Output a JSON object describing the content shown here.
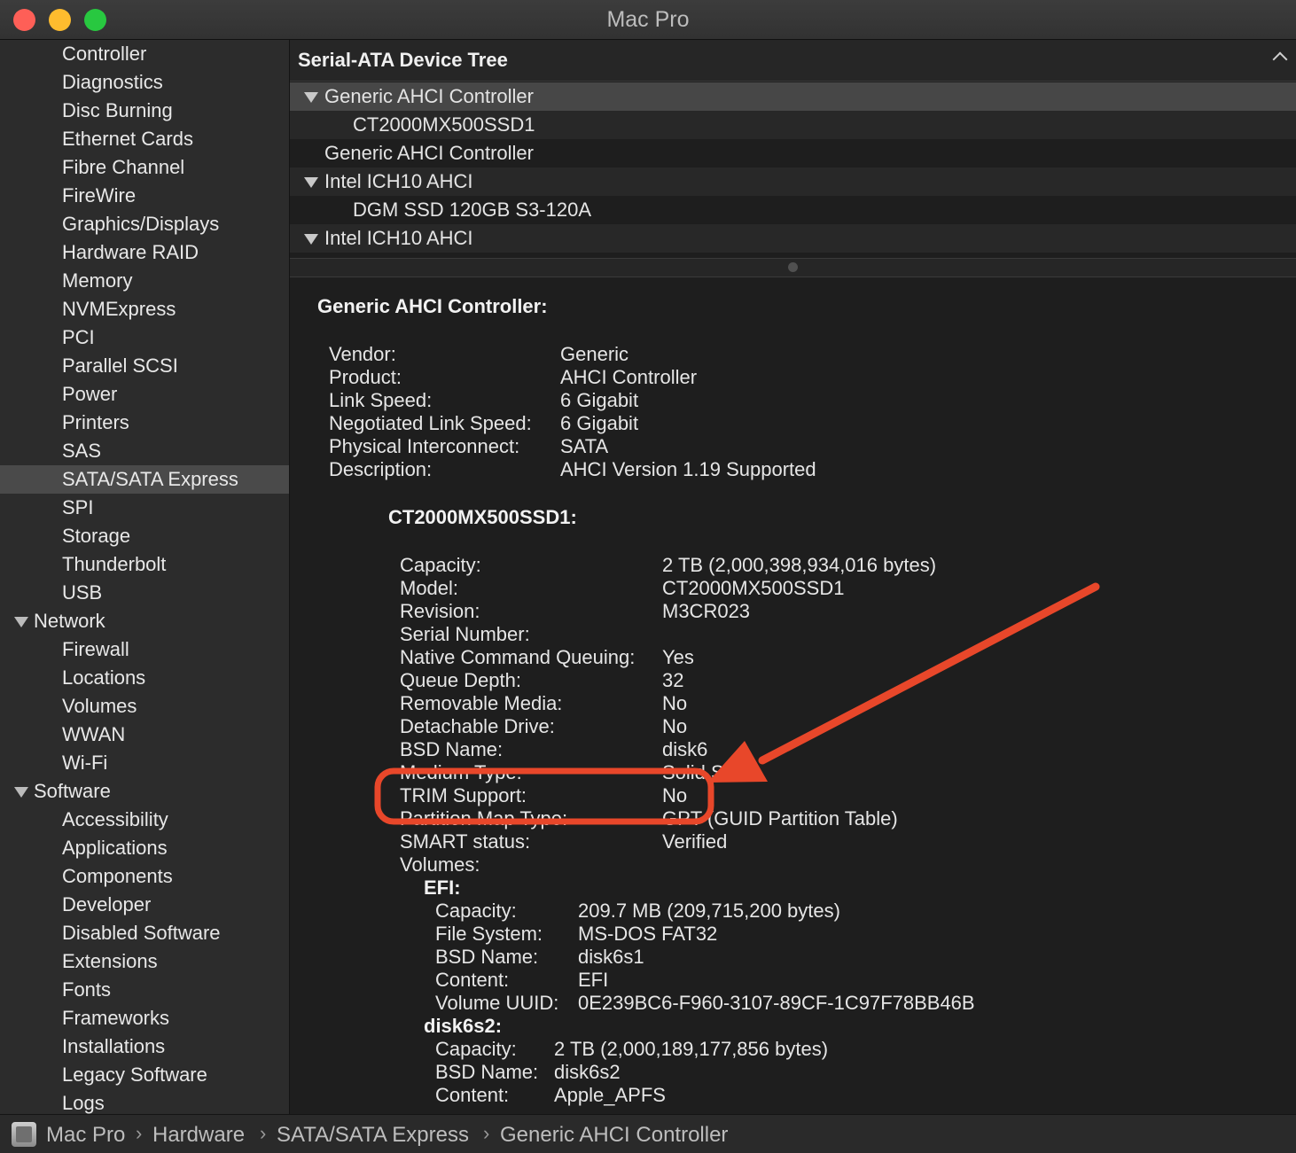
{
  "window": {
    "title": "Mac Pro"
  },
  "sidebar": {
    "items": [
      {
        "label": "Controller",
        "kind": "item"
      },
      {
        "label": "Diagnostics",
        "kind": "item"
      },
      {
        "label": "Disc Burning",
        "kind": "item"
      },
      {
        "label": "Ethernet Cards",
        "kind": "item"
      },
      {
        "label": "Fibre Channel",
        "kind": "item"
      },
      {
        "label": "FireWire",
        "kind": "item"
      },
      {
        "label": "Graphics/Displays",
        "kind": "item"
      },
      {
        "label": "Hardware RAID",
        "kind": "item"
      },
      {
        "label": "Memory",
        "kind": "item"
      },
      {
        "label": "NVMExpress",
        "kind": "item"
      },
      {
        "label": "PCI",
        "kind": "item"
      },
      {
        "label": "Parallel SCSI",
        "kind": "item"
      },
      {
        "label": "Power",
        "kind": "item"
      },
      {
        "label": "Printers",
        "kind": "item"
      },
      {
        "label": "SAS",
        "kind": "item"
      },
      {
        "label": "SATA/SATA Express",
        "kind": "item",
        "selected": true
      },
      {
        "label": "SPI",
        "kind": "item"
      },
      {
        "label": "Storage",
        "kind": "item"
      },
      {
        "label": "Thunderbolt",
        "kind": "item"
      },
      {
        "label": "USB",
        "kind": "item"
      },
      {
        "label": "Network",
        "kind": "category"
      },
      {
        "label": "Firewall",
        "kind": "item"
      },
      {
        "label": "Locations",
        "kind": "item"
      },
      {
        "label": "Volumes",
        "kind": "item"
      },
      {
        "label": "WWAN",
        "kind": "item"
      },
      {
        "label": "Wi-Fi",
        "kind": "item"
      },
      {
        "label": "Software",
        "kind": "category"
      },
      {
        "label": "Accessibility",
        "kind": "item"
      },
      {
        "label": "Applications",
        "kind": "item"
      },
      {
        "label": "Components",
        "kind": "item"
      },
      {
        "label": "Developer",
        "kind": "item"
      },
      {
        "label": "Disabled Software",
        "kind": "item"
      },
      {
        "label": "Extensions",
        "kind": "item"
      },
      {
        "label": "Fonts",
        "kind": "item"
      },
      {
        "label": "Frameworks",
        "kind": "item"
      },
      {
        "label": "Installations",
        "kind": "item"
      },
      {
        "label": "Legacy Software",
        "kind": "item"
      },
      {
        "label": "Logs",
        "kind": "item"
      }
    ]
  },
  "device_tree": {
    "title": "Serial-ATA Device Tree",
    "rows": [
      {
        "label": "Generic AHCI Controller",
        "level": 0,
        "expanded": true,
        "selected": true
      },
      {
        "label": "CT2000MX500SSD1",
        "level": 1
      },
      {
        "label": "Generic AHCI Controller",
        "level": 0
      },
      {
        "label": "Intel ICH10 AHCI",
        "level": 0,
        "expanded": true
      },
      {
        "label": "DGM SSD 120GB S3-120A",
        "level": 1
      },
      {
        "label": "Intel ICH10 AHCI",
        "level": 0,
        "expanded": true
      }
    ]
  },
  "detail": {
    "title": "Generic AHCI Controller:",
    "controller_fields": [
      {
        "key": "Vendor:",
        "value": "Generic"
      },
      {
        "key": "Product:",
        "value": "AHCI Controller"
      },
      {
        "key": "Link Speed:",
        "value": "6 Gigabit"
      },
      {
        "key": "Negotiated Link Speed:",
        "value": "6 Gigabit"
      },
      {
        "key": "Physical Interconnect:",
        "value": "SATA"
      },
      {
        "key": "Description:",
        "value": "AHCI Version 1.19 Supported"
      }
    ],
    "device_title": "CT2000MX500SSD1:",
    "device_fields": [
      {
        "key": "Capacity:",
        "value": "2 TB (2,000,398,934,016 bytes)"
      },
      {
        "key": "Model:",
        "value": "CT2000MX500SSD1"
      },
      {
        "key": "Revision:",
        "value": "M3CR023"
      },
      {
        "key": "Serial Number:",
        "value": ""
      },
      {
        "key": "Native Command Queuing:",
        "value": "Yes"
      },
      {
        "key": "Queue Depth:",
        "value": "32"
      },
      {
        "key": "Removable Media:",
        "value": "No"
      },
      {
        "key": "Detachable Drive:",
        "value": "No"
      },
      {
        "key": "BSD Name:",
        "value": "disk6"
      },
      {
        "key": "Medium Type:",
        "value": "Solid State"
      },
      {
        "key": "TRIM Support:",
        "value": "No"
      },
      {
        "key": "Partition Map Type:",
        "value": "GPT (GUID Partition Table)"
      },
      {
        "key": "SMART status:",
        "value": "Verified"
      },
      {
        "key": "Volumes:",
        "value": ""
      }
    ],
    "volumes": [
      {
        "name": "EFI:",
        "fields": [
          {
            "key": "Capacity:",
            "value": "209.7 MB (209,715,200 bytes)"
          },
          {
            "key": "File System:",
            "value": "MS-DOS FAT32"
          },
          {
            "key": "BSD Name:",
            "value": "disk6s1"
          },
          {
            "key": "Content:",
            "value": "EFI"
          },
          {
            "key": "Volume UUID:",
            "value": "0E239BC6-F960-3107-89CF-1C97F78BB46B"
          }
        ]
      },
      {
        "name": "disk6s2:",
        "fields": [
          {
            "key": "Capacity:",
            "value": "2 TB (2,000,189,177,856 bytes)"
          },
          {
            "key": "BSD Name:",
            "value": "disk6s2"
          },
          {
            "key": "Content:",
            "value": "Apple_APFS"
          }
        ]
      }
    ]
  },
  "annotation": {
    "color": "#e8472a",
    "highlighted_field": "TRIM Support:"
  },
  "breadcrumb": [
    "Mac Pro",
    "Hardware",
    "SATA/SATA Express",
    "Generic AHCI Controller"
  ]
}
